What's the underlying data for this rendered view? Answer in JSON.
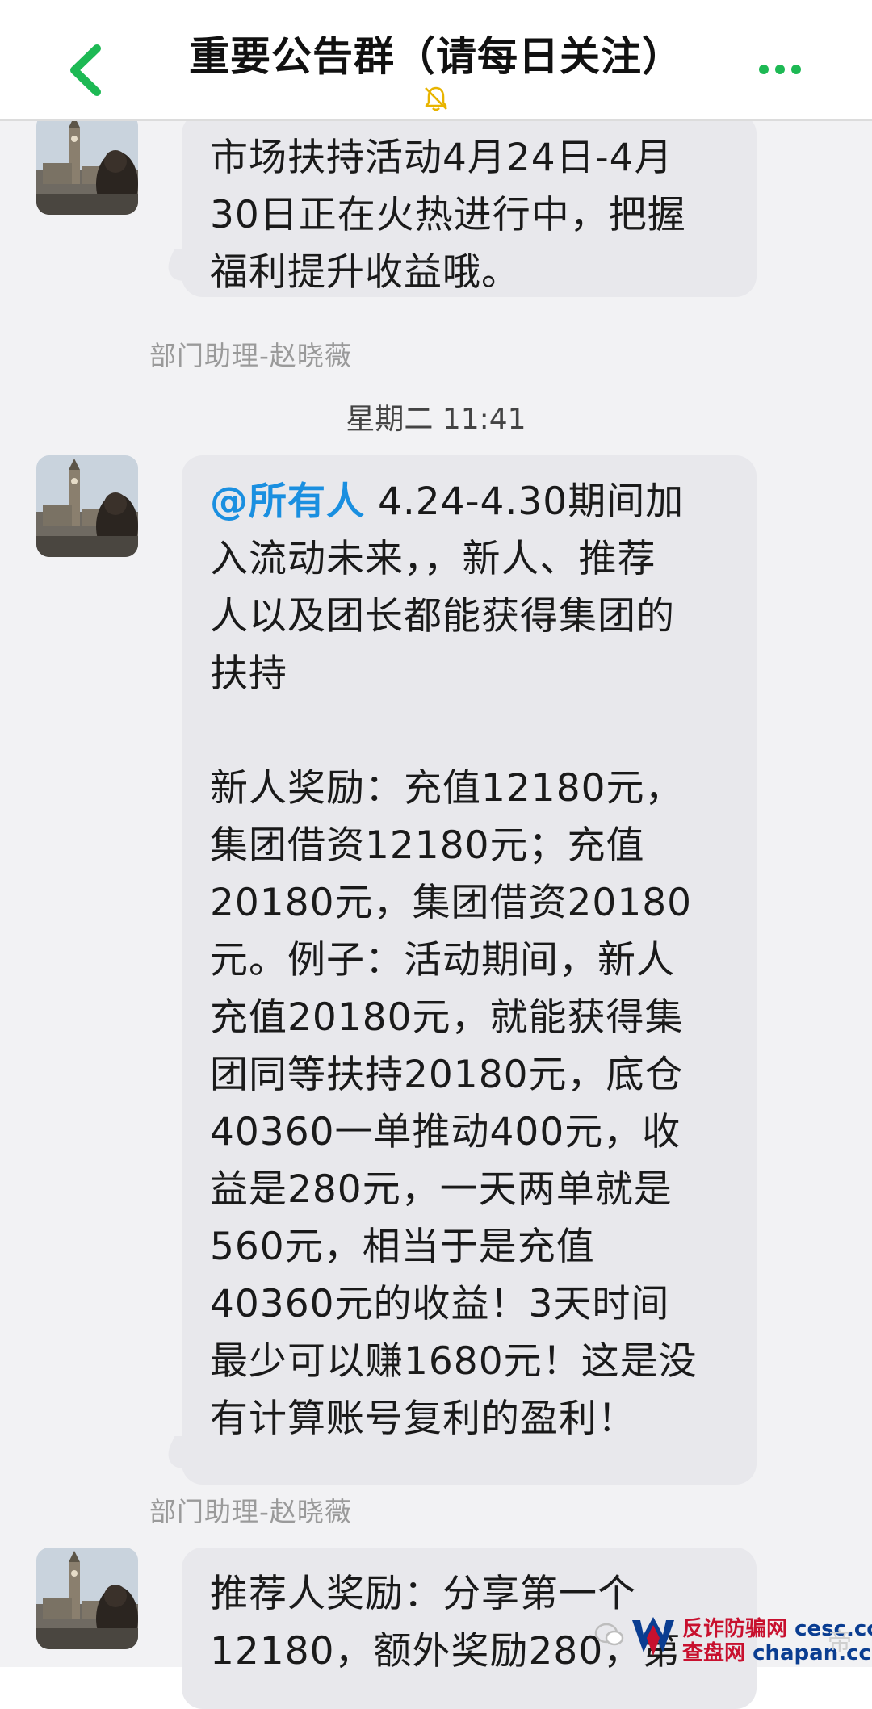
{
  "header": {
    "title": "重要公告群（请每日关注）",
    "back_icon": "chevron-left-icon",
    "mute_icon": "bell-mute-icon",
    "more_icon": "more-dots-icon",
    "accent_color": "#1db954"
  },
  "messages": [
    {
      "sender": "部门助理-赵晓薇",
      "avatar_icon": "avatar-photo-big-ben",
      "lines": [
        "市场扶持活动4月24日-4月",
        "30日正在火热进行中，把握",
        "福利提升收益哦。"
      ]
    },
    {
      "timestamp": "星期二 11:41"
    },
    {
      "sender": "部门助理-赵晓薇",
      "avatar_icon": "avatar-photo-big-ben",
      "mention": "@所有人",
      "lines": [
        " 4.24-4.30期间加",
        "入流动未来，，新人、推荐",
        "人以及团长都能获得集团的",
        "扶持",
        "",
        "新人奖励：充值12180元，",
        "集团借资12180元；充值",
        "20180元，集团借资20180",
        "元。例子：活动期间，新人",
        "充值20180元，就能获得集",
        "团同等扶持20180元，底仓",
        "40360一单推动400元，收",
        "益是280元，一天两单就是",
        "560元，相当于是充值",
        "40360元的收益！3天时间",
        "最少可以赚1680元！这是没",
        "有计算账号复利的盈利！"
      ]
    },
    {
      "sender": "",
      "avatar_icon": "avatar-photo-big-ben",
      "lines": [
        "推荐人奖励：分享第一个",
        "12180，额外奖励280，第"
      ]
    }
  ],
  "watermark": {
    "line1": "反诈防骗网",
    "line1_domain": "cesc.cc",
    "line2": "查盘网",
    "line2_domain": "chapan.cc",
    "faint": "帝"
  }
}
